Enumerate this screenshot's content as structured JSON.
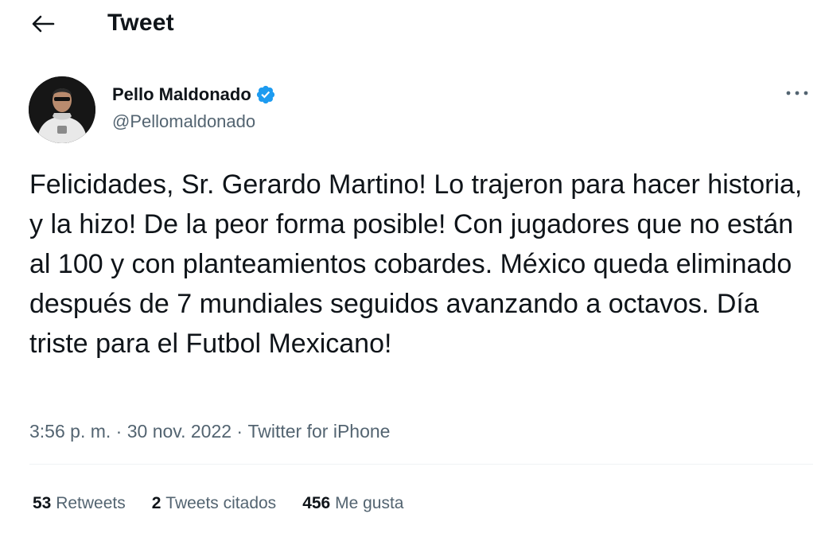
{
  "header": {
    "title": "Tweet",
    "back_icon": "arrow-left-icon"
  },
  "author": {
    "name": "Pello Maldonado",
    "handle": "@Pellomaldonado",
    "verified": true,
    "verified_color": "#1d9bf0"
  },
  "more_icon": "more-horizontal-icon",
  "tweet": {
    "text": "Felicidades, Sr. Gerardo Martino! Lo trajeron para hacer historia, y la hizo! De la peor forma posible! Con jugadores que no están al 100 y con planteamientos cobardes. México queda eliminado después de 7 mundiales seguidos avanzando a octavos. Día triste para el Futbol Mexicano!",
    "time": "3:56 p. m.",
    "separator": " · ",
    "date": "30 nov. 2022",
    "source": "Twitter for iPhone"
  },
  "stats": [
    {
      "count": "53",
      "label": "Retweets"
    },
    {
      "count": "2",
      "label": "Tweets citados"
    },
    {
      "count": "456",
      "label": "Me gusta"
    }
  ]
}
